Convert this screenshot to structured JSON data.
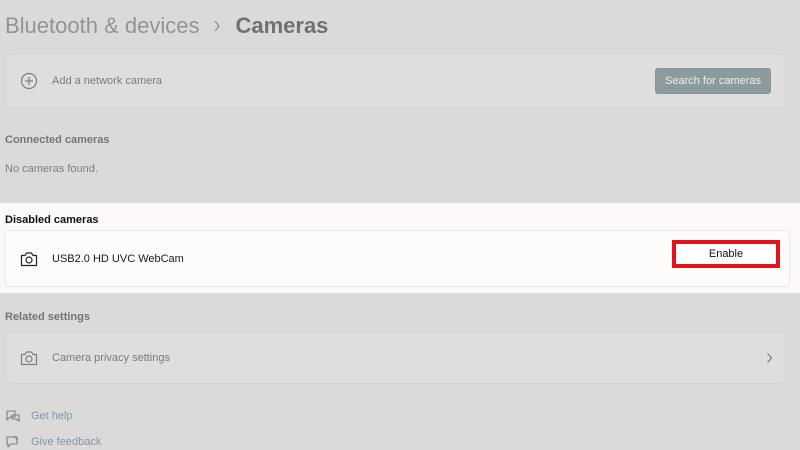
{
  "breadcrumb": {
    "parent": "Bluetooth & devices",
    "current": "Cameras"
  },
  "network_camera": {
    "label": "Add a network camera",
    "icon": "plus-circle-icon",
    "search_button": "Search for cameras"
  },
  "connected_cameras": {
    "title": "Connected cameras",
    "empty_text": "No cameras found."
  },
  "disabled_cameras": {
    "title": "Disabled cameras",
    "items": [
      {
        "name": "USB2.0 HD UVC WebCam",
        "icon": "camera-icon",
        "action": "Enable"
      }
    ]
  },
  "related_settings": {
    "title": "Related settings",
    "items": [
      {
        "label": "Camera privacy settings",
        "icon": "camera-icon"
      }
    ]
  },
  "footer": {
    "get_help": "Get help",
    "give_feedback": "Give feedback"
  },
  "colors": {
    "accent_button": "#4a6a6f",
    "highlight_border": "#e2141b",
    "link": "#3d5a7a"
  }
}
